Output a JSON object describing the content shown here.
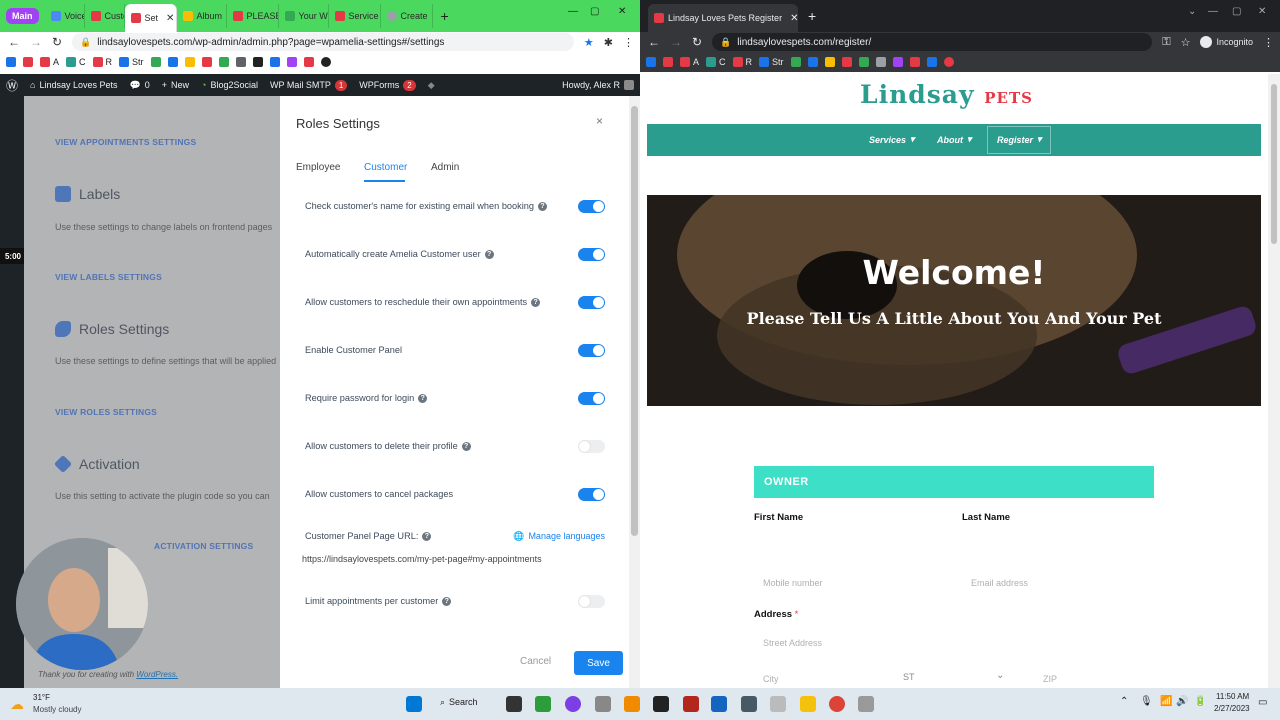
{
  "left_window": {
    "group_chip": "Main",
    "tabs": [
      {
        "label": "Voice",
        "color": "#4a8af4"
      },
      {
        "label": "Custor",
        "color": "#e63946"
      },
      {
        "label": "Set",
        "color": "#e63946",
        "active": true
      },
      {
        "label": "Album",
        "color": "#fbbc04"
      },
      {
        "label": "PLEASE",
        "color": "#e63946"
      },
      {
        "label": "Your W",
        "color": "#34a853"
      },
      {
        "label": "Service",
        "color": "#e63946"
      },
      {
        "label": "Create",
        "color": "#9aa0a6"
      }
    ],
    "new_tab": "+",
    "url": "lindsaylovespets.com/wp-admin/admin.php?page=wpamelia-settings#/settings",
    "bookmarks": [
      "A",
      "C",
      "R",
      "Str"
    ]
  },
  "wp_admin_bar": {
    "site_name": "Lindsay Loves Pets",
    "comments": "0",
    "new": "New",
    "blog2social": "Blog2Social",
    "wp_mail_smtp": "WP Mail SMTP",
    "wp_mail_badge": "1",
    "wpforms": "WPForms",
    "wpforms_badge": "2",
    "howdy": "Howdy, Alex R"
  },
  "settings_bg": {
    "appointments_link": "VIEW APPOINTMENTS SETTINGS",
    "labels_title": "Labels",
    "labels_desc": "Use these settings to change labels on frontend pages",
    "labels_link": "VIEW LABELS SETTINGS",
    "roles_title": "Roles Settings",
    "roles_desc": "Use these settings to define settings that will be applied",
    "roles_link": "VIEW ROLES SETTINGS",
    "activation_title": "Activation",
    "activation_desc": "Use this setting to activate the plugin code so you can",
    "activation_link": "ACTIVATION SETTINGS",
    "footer": "Thank you for creating with",
    "footer_link": "WordPress.",
    "timer": "5:00"
  },
  "modal": {
    "title": "Roles Settings",
    "close": "×",
    "tabs": [
      "Employee",
      "Customer",
      "Admin"
    ],
    "active_tab": "Customer",
    "settings": [
      {
        "label": "Check customer's name for existing email when booking",
        "on": true,
        "help": true
      },
      {
        "label": "Automatically create Amelia Customer user",
        "on": true,
        "help": true
      },
      {
        "label": "Allow customers to reschedule their own appointments",
        "on": true,
        "help": true
      },
      {
        "label": "Enable Customer Panel",
        "on": true,
        "help": false
      },
      {
        "label": "Require password for login",
        "on": true,
        "help": true
      },
      {
        "label": "Allow customers to delete their profile",
        "on": false,
        "help": true
      },
      {
        "label": "Allow customers to cancel packages",
        "on": true,
        "help": false
      }
    ],
    "panel_url_label": "Customer Panel Page URL:",
    "manage_languages": "Manage languages",
    "panel_url_value": "https://lindsaylovespets.com/my-pet-page#my-appointments",
    "limit_label": "Limit appointments per customer",
    "limit_on": false,
    "cancel": "Cancel",
    "save": "Save"
  },
  "right_window": {
    "tab_title": "Lindsay Loves Pets Register",
    "url": "lindsaylovespets.com/register/",
    "incognito": "Incognito",
    "bookmarks": [
      "A",
      "C",
      "R",
      "Str"
    ]
  },
  "site": {
    "logo_main": "Lindsay",
    "logo_pets": "PETS",
    "nav": [
      "Services",
      "About",
      "Register"
    ],
    "hero_title": "Welcome!",
    "hero_subtitle": "Please Tell Us A Little About You And Your Pet",
    "owner_heading": "OWNER",
    "first_name": "First Name",
    "last_name": "Last Name",
    "mobile_placeholder": "Mobile number",
    "email_placeholder": "Email address",
    "address_label": "Address",
    "required_mark": "*",
    "street_placeholder": "Street Address",
    "city_placeholder": "City",
    "state_placeholder": "ST",
    "zip_placeholder": "ZIP"
  },
  "taskbar": {
    "temp": "31°F",
    "weather": "Mostly cloudy",
    "search": "Search",
    "time": "11:50 AM",
    "date": "2/27/2023"
  },
  "colors": {
    "brand_teal": "#2a9d8f",
    "owner_bar": "#3ddfc6",
    "toggle_on": "#1a84ee",
    "tab_group": "#a142f4"
  }
}
